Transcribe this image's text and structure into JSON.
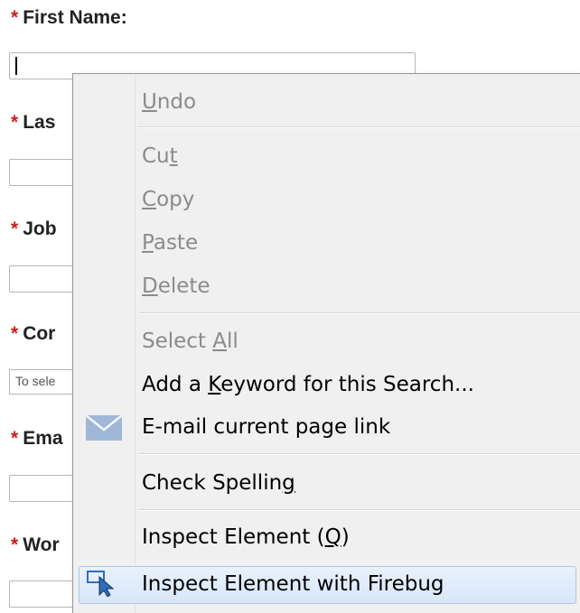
{
  "form": {
    "required_marker": "*",
    "fields": [
      {
        "label": "First Name:"
      },
      {
        "label": "Las"
      },
      {
        "label": "Job"
      },
      {
        "label": "Cor"
      },
      {
        "label": "Ema"
      },
      {
        "label": "Wor"
      }
    ],
    "select_placeholder": "To sele"
  },
  "context_menu": {
    "items": [
      {
        "pre": "",
        "key": "U",
        "post": "ndo",
        "disabled": true
      },
      {
        "pre": "Cu",
        "key": "t",
        "post": "",
        "disabled": true
      },
      {
        "pre": "",
        "key": "C",
        "post": "opy",
        "disabled": true
      },
      {
        "pre": "",
        "key": "P",
        "post": "aste",
        "disabled": true
      },
      {
        "pre": "",
        "key": "D",
        "post": "elete",
        "disabled": true
      },
      {
        "pre": "Select ",
        "key": "A",
        "post": "ll",
        "disabled": true
      },
      {
        "pre": "Add a ",
        "key": "K",
        "post": "eyword for this Search...",
        "disabled": false
      },
      {
        "pre": "E-mail current page link",
        "key": "",
        "post": "",
        "disabled": false,
        "icon": "envelope-icon"
      },
      {
        "pre": "Check Spellin",
        "key": "g",
        "post": "",
        "disabled": false
      },
      {
        "pre": "Inspect Element (",
        "key": "Q",
        "post": ")",
        "disabled": false
      },
      {
        "pre": "Inspect Element with Firebug",
        "key": "",
        "post": "",
        "disabled": false,
        "icon": "firebug-inspect-icon",
        "highlighted": true
      }
    ]
  },
  "colors": {
    "required": "#cc1f1f",
    "menu_background": "#f0f0f0",
    "disabled_text": "#8b8b8b",
    "highlight": "#d8e7f9"
  }
}
